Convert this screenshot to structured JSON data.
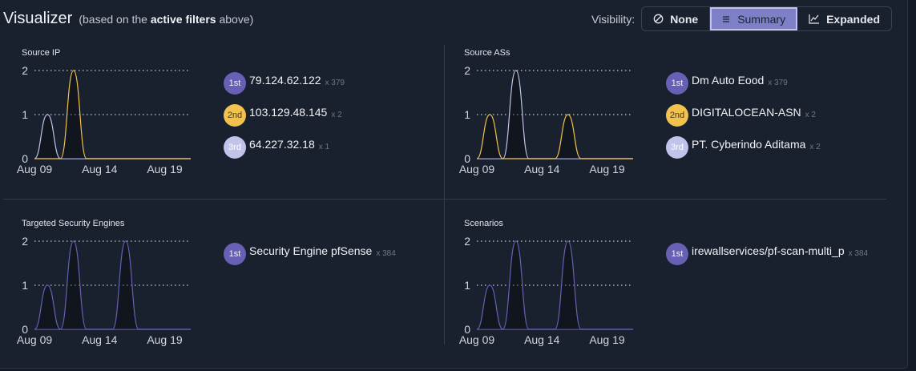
{
  "header": {
    "title": "Visualizer",
    "subtitle_pre": "(based on the",
    "subtitle_bold": "active filters",
    "subtitle_post": "above)"
  },
  "visibility": {
    "label": "Visibility:",
    "options": [
      {
        "label": "None",
        "icon": "slash-circle-icon",
        "active": false
      },
      {
        "label": "Summary",
        "icon": "list-icon",
        "active": true
      },
      {
        "label": "Expanded",
        "icon": "line-chart-icon",
        "active": false
      }
    ]
  },
  "colors": {
    "purple": "#6760b4",
    "yellow": "#f2c14e",
    "lavender": "#c2c3ea",
    "accent": "#7d80c7"
  },
  "panels": [
    {
      "title": "Source IP",
      "top": [
        {
          "rank": "1st",
          "name": "79.124.62.122",
          "count": "x 379"
        },
        {
          "rank": "2nd",
          "name": "103.129.48.145",
          "count": "x 2"
        },
        {
          "rank": "3rd",
          "name": "64.227.32.18",
          "count": "x 1"
        }
      ]
    },
    {
      "title": "Source ASs",
      "top": [
        {
          "rank": "1st",
          "name": "Dm Auto Eood",
          "count": "x 379"
        },
        {
          "rank": "2nd",
          "name": "DIGITALOCEAN-ASN",
          "count": "x 2"
        },
        {
          "rank": "3rd",
          "name": "PT. Cyberindo Aditama",
          "count": "x 2"
        }
      ]
    },
    {
      "title": "Targeted Security Engines",
      "top": [
        {
          "rank": "1st",
          "name": "Security Engine pfSense",
          "count": "x 384"
        }
      ]
    },
    {
      "title": "Scenarios",
      "top": [
        {
          "rank": "1st",
          "name": "irewallservices/pf-scan-multi_p",
          "count": "x 384"
        }
      ]
    }
  ],
  "chart_data": [
    {
      "type": "line",
      "title": "Source IP",
      "x": [
        "Aug 09",
        "Aug 10",
        "Aug 11",
        "Aug 12",
        "Aug 13",
        "Aug 14",
        "Aug 15",
        "Aug 16",
        "Aug 17",
        "Aug 18",
        "Aug 19",
        "Aug 20",
        "Aug 21"
      ],
      "x_tick_labels": [
        "Aug 09",
        "Aug 14",
        "Aug 19"
      ],
      "ylim": [
        0,
        2
      ],
      "y_ticks": [
        "0",
        "1",
        "2"
      ],
      "series": [
        {
          "color": "#c2c3ea",
          "values": [
            0,
            1,
            0,
            0,
            0,
            0,
            0,
            0,
            0,
            0,
            0,
            0,
            0
          ]
        },
        {
          "color": "#f2c14e",
          "values": [
            0,
            0,
            0,
            2,
            0,
            0,
            0,
            0,
            0,
            0,
            0,
            0,
            0
          ]
        }
      ]
    },
    {
      "type": "line",
      "title": "Source ASs",
      "x": [
        "Aug 09",
        "Aug 10",
        "Aug 11",
        "Aug 12",
        "Aug 13",
        "Aug 14",
        "Aug 15",
        "Aug 16",
        "Aug 17",
        "Aug 18",
        "Aug 19",
        "Aug 20",
        "Aug 21"
      ],
      "x_tick_labels": [
        "Aug 09",
        "Aug 14",
        "Aug 19"
      ],
      "ylim": [
        0,
        2
      ],
      "y_ticks": [
        "0",
        "1",
        "2"
      ],
      "series": [
        {
          "color": "#c2c3ea",
          "values": [
            0,
            0,
            0,
            2,
            0,
            0,
            0,
            0,
            0,
            0,
            0,
            0,
            0
          ]
        },
        {
          "color": "#f2c14e",
          "values": [
            0,
            1,
            0,
            0,
            0,
            0,
            0,
            1,
            0,
            0,
            0,
            0,
            0
          ]
        }
      ]
    },
    {
      "type": "line",
      "title": "Targeted Security Engines",
      "x": [
        "Aug 09",
        "Aug 10",
        "Aug 11",
        "Aug 12",
        "Aug 13",
        "Aug 14",
        "Aug 15",
        "Aug 16",
        "Aug 17",
        "Aug 18",
        "Aug 19",
        "Aug 20",
        "Aug 21"
      ],
      "x_tick_labels": [
        "Aug 09",
        "Aug 14",
        "Aug 19"
      ],
      "ylim": [
        0,
        2
      ],
      "y_ticks": [
        "0",
        "1",
        "2"
      ],
      "series": [
        {
          "color": "#6760b4",
          "values": [
            0,
            1,
            0,
            2,
            0,
            0,
            0,
            2,
            0,
            0,
            0,
            0,
            0
          ]
        }
      ]
    },
    {
      "type": "line",
      "title": "Scenarios",
      "x": [
        "Aug 09",
        "Aug 10",
        "Aug 11",
        "Aug 12",
        "Aug 13",
        "Aug 14",
        "Aug 15",
        "Aug 16",
        "Aug 17",
        "Aug 18",
        "Aug 19",
        "Aug 20",
        "Aug 21"
      ],
      "x_tick_labels": [
        "Aug 09",
        "Aug 14",
        "Aug 19"
      ],
      "ylim": [
        0,
        2
      ],
      "y_ticks": [
        "0",
        "1",
        "2"
      ],
      "series": [
        {
          "color": "#6760b4",
          "values": [
            0,
            1,
            0,
            2,
            0,
            0,
            0,
            2,
            0,
            0,
            0,
            0,
            0
          ]
        }
      ]
    }
  ]
}
